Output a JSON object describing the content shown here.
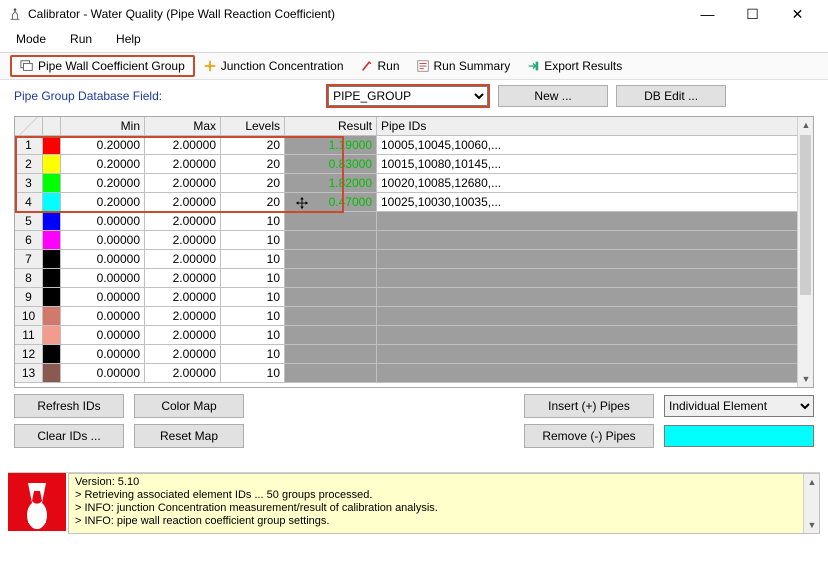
{
  "window": {
    "title": "Calibrator - Water Quality (Pipe Wall Reaction Coefficient)"
  },
  "menu": {
    "mode": "Mode",
    "run": "Run",
    "help": "Help"
  },
  "tabs": {
    "pipe_wall": "Pipe Wall Coefficient Group",
    "junction": "Junction Concentration",
    "run": "Run",
    "run_summary": "Run Summary",
    "export": "Export Results"
  },
  "fieldrow": {
    "label": "Pipe Group Database Field:",
    "select_value": "PIPE_GROUP",
    "new_btn": "New ...",
    "dbedit_btn": "DB Edit ..."
  },
  "columns": {
    "min": "Min",
    "max": "Max",
    "levels": "Levels",
    "result": "Result",
    "pipe_ids": "Pipe IDs"
  },
  "rows": [
    {
      "idx": "1",
      "color": "#ff0000",
      "min": "0.20000",
      "max": "2.00000",
      "levels": "20",
      "result": "1.19000",
      "pipes": "10005,10045,10060,..."
    },
    {
      "idx": "2",
      "color": "#ffff00",
      "min": "0.20000",
      "max": "2.00000",
      "levels": "20",
      "result": "0.83000",
      "pipes": "10015,10080,10145,..."
    },
    {
      "idx": "3",
      "color": "#00ff00",
      "min": "0.20000",
      "max": "2.00000",
      "levels": "20",
      "result": "1.82000",
      "pipes": "10020,10085,12680,..."
    },
    {
      "idx": "4",
      "color": "#00ffff",
      "min": "0.20000",
      "max": "2.00000",
      "levels": "20",
      "result": "0.47000",
      "pipes": "10025,10030,10035,..."
    },
    {
      "idx": "5",
      "color": "#0000ff",
      "min": "0.00000",
      "max": "2.00000",
      "levels": "10",
      "result": "",
      "pipes": ""
    },
    {
      "idx": "6",
      "color": "#ff00ff",
      "min": "0.00000",
      "max": "2.00000",
      "levels": "10",
      "result": "",
      "pipes": ""
    },
    {
      "idx": "7",
      "color": "#000000",
      "min": "0.00000",
      "max": "2.00000",
      "levels": "10",
      "result": "",
      "pipes": ""
    },
    {
      "idx": "8",
      "color": "#000000",
      "min": "0.00000",
      "max": "2.00000",
      "levels": "10",
      "result": "",
      "pipes": ""
    },
    {
      "idx": "9",
      "color": "#000000",
      "min": "0.00000",
      "max": "2.00000",
      "levels": "10",
      "result": "",
      "pipes": ""
    },
    {
      "idx": "10",
      "color": "#d17a6b",
      "min": "0.00000",
      "max": "2.00000",
      "levels": "10",
      "result": "",
      "pipes": ""
    },
    {
      "idx": "11",
      "color": "#f39c8e",
      "min": "0.00000",
      "max": "2.00000",
      "levels": "10",
      "result": "",
      "pipes": ""
    },
    {
      "idx": "12",
      "color": "#000000",
      "min": "0.00000",
      "max": "2.00000",
      "levels": "10",
      "result": "",
      "pipes": ""
    },
    {
      "idx": "13",
      "color": "#8a5a50",
      "min": "0.00000",
      "max": "2.00000",
      "levels": "10",
      "result": "",
      "pipes": ""
    }
  ],
  "buttons": {
    "refresh": "Refresh IDs",
    "colormap": "Color Map",
    "clear": "Clear IDs ...",
    "reset": "Reset Map",
    "insert": "Insert (+) Pipes",
    "remove": "Remove (-) Pipes",
    "element_mode": "Individual Element",
    "colorpick": "#00ffff"
  },
  "log": {
    "version_label": "Version: 5.10",
    "line1": "> Retrieving associated element IDs ... 50 groups processed.",
    "line2": "> INFO: junction Concentration measurement/result of calibration analysis.",
    "line3": "> INFO: pipe wall reaction coefficient group settings."
  }
}
